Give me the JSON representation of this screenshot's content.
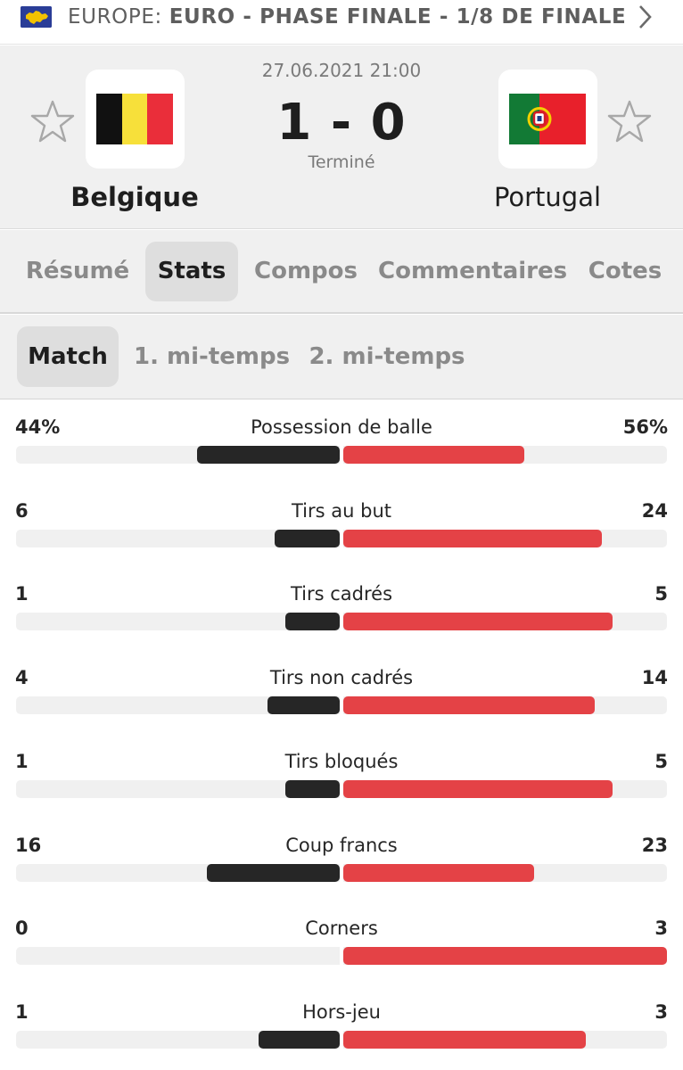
{
  "competition": {
    "region": "EUROPE:",
    "name": "EURO - PHASE FINALE - 1/8 DE FINALE",
    "region_flag_icon": "eu-flag-icon",
    "next_icon": "chevron-right-icon"
  },
  "match": {
    "datetime": "27.06.2021 21:00",
    "score": "1 - 0",
    "status": "Terminé",
    "home": {
      "name": "Belgique",
      "flag_colors": [
        "#111111",
        "#f7e03a",
        "#ea2e3a"
      ]
    },
    "away": {
      "name": "Portugal",
      "flag_colors": [
        "#127a35",
        "#e8202b"
      ]
    },
    "favorite_icon": "star-outline-icon"
  },
  "tabs": [
    {
      "label": "Résumé",
      "active": false
    },
    {
      "label": "Stats",
      "active": true
    },
    {
      "label": "Compos",
      "active": false
    },
    {
      "label": "Commentaires",
      "active": false
    },
    {
      "label": "Cotes",
      "active": false
    }
  ],
  "subtabs": [
    {
      "label": "Match",
      "active": true
    },
    {
      "label": "1. mi-temps",
      "active": false
    },
    {
      "label": "2. mi-temps",
      "active": false
    }
  ],
  "colors": {
    "home_bar": "#262626",
    "away_bar": "#e44246",
    "track": "#f0f0f0"
  },
  "stats": [
    {
      "label": "Possession de balle",
      "home": "44%",
      "away": "56%",
      "home_share": 0.44,
      "away_share": 0.56
    },
    {
      "label": "Tirs au but",
      "home": "6",
      "away": "24",
      "home_share": 0.2,
      "away_share": 0.8
    },
    {
      "label": "Tirs cadrés",
      "home": "1",
      "away": "5",
      "home_share": 0.167,
      "away_share": 0.833
    },
    {
      "label": "Tirs non cadrés",
      "home": "4",
      "away": "14",
      "home_share": 0.222,
      "away_share": 0.778
    },
    {
      "label": "Tirs bloqués",
      "home": "1",
      "away": "5",
      "home_share": 0.167,
      "away_share": 0.833
    },
    {
      "label": "Coup francs",
      "home": "16",
      "away": "23",
      "home_share": 0.41,
      "away_share": 0.59
    },
    {
      "label": "Corners",
      "home": "0",
      "away": "3",
      "home_share": 0,
      "away_share": 1
    },
    {
      "label": "Hors-jeu",
      "home": "1",
      "away": "3",
      "home_share": 0.25,
      "away_share": 0.75
    }
  ]
}
